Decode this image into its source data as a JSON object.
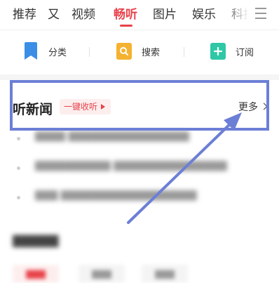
{
  "tabs": [
    {
      "label": "推荐",
      "active": false
    },
    {
      "label": "又",
      "active": false
    },
    {
      "label": "视频",
      "active": false
    },
    {
      "label": "畅听",
      "active": true
    },
    {
      "label": "图片",
      "active": false
    },
    {
      "label": "娱乐",
      "active": false
    },
    {
      "label": "科技",
      "active": false
    }
  ],
  "menu_icon": "hamburger-menu-icon",
  "functions": [
    {
      "label": "分类",
      "icon": "bookmark-icon",
      "color": "#3a8ee6"
    },
    {
      "label": "搜索",
      "icon": "search-icon",
      "color": "#f5b230"
    },
    {
      "label": "订阅",
      "icon": "add-subscribe-icon",
      "color": "#2fc7a5"
    }
  ],
  "news_section": {
    "title": "听新闻",
    "one_click_label": "一键收听",
    "more_label": "更多"
  },
  "colors": {
    "accent": "#e8424a",
    "annotation": "#6c7fd6"
  }
}
